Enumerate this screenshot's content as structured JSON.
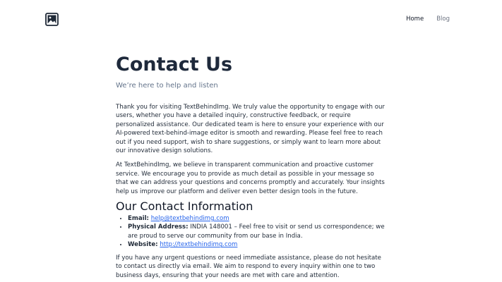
{
  "nav": {
    "home": "Home",
    "blog": "Blog"
  },
  "page": {
    "title": "Contact Us",
    "subtitle": "We’re here to help and listen",
    "para1": "Thank you for visiting TextBehindImg. We truly value the opportunity to engage with our users, whether you have a detailed inquiry, constructive feedback, or require personalized assistance. Our dedicated team is here to ensure your experience with our AI-powered text-behind-image editor is smooth and rewarding. Please feel free to reach out if you need support, wish to share suggestions, or simply want to learn more about our innovative design solutions.",
    "para2": "At TextBehindImg, we believe in transparent communication and proactive customer service. We encourage you to provide as much detail as possible in your message so that we can address your questions and concerns promptly and accurately. Your insights help us improve our platform and deliver even better design tools in the future.",
    "contact_heading": "Our Contact Information",
    "contact": {
      "email_label": "Email:",
      "email_value": "help@textbehindimg.com",
      "address_label": "Physical Address:",
      "address_value": " INDIA 148001 – Feel free to visit or send us correspondence; we are proud to serve our community from our base in India.",
      "website_label": "Website:",
      "website_value": "http://textbehindimg.com"
    },
    "para3": "If you have any urgent questions or need immediate assistance, please do not hesitate to contact us directly via email. We aim to respond to every inquiry within one to two business days, ensuring that your needs are met with care and attention."
  }
}
